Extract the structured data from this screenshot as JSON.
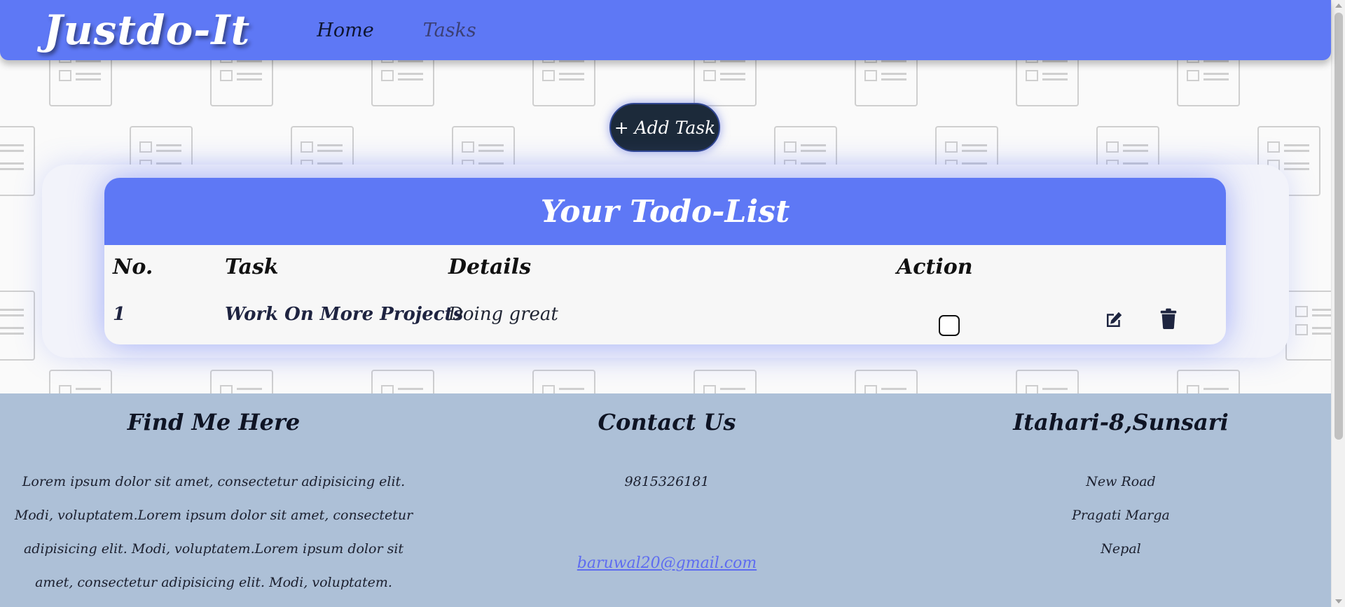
{
  "navbar": {
    "brand": "Justdo-It",
    "links": [
      "Home",
      "Tasks"
    ]
  },
  "actions": {
    "add_task_label": "+ Add Task"
  },
  "todo": {
    "title": "Your Todo-List",
    "columns": [
      "No.",
      "Task",
      "Details",
      "Action"
    ],
    "rows": [
      {
        "no": "1",
        "task": "Work On More Projects",
        "details": "Doing great",
        "done": false
      }
    ]
  },
  "footer": {
    "find_me": {
      "heading": "Find Me Here",
      "text": "Lorem ipsum dolor sit amet, consectetur adipisicing elit. Modi, voluptatem.Lorem ipsum dolor sit amet, consectetur adipisicing elit. Modi, voluptatem.Lorem ipsum dolor sit amet, consectetur adipisicing elit. Modi, voluptatem."
    },
    "contact": {
      "heading": "Contact Us",
      "phone": "9815326181",
      "email": "baruwal20@gmail.com"
    },
    "address": {
      "heading": "Itahari-8,Sunsari",
      "lines": [
        "New Road",
        "Pragati Marga",
        "Nepal"
      ]
    }
  },
  "colors": {
    "navbar": "#5e78f5",
    "footer": "#adc0d7",
    "add_button": "#1c2a3a",
    "email_link": "#5e6cf0"
  },
  "icons": [
    "edit-icon",
    "trash-icon",
    "document-icon"
  ]
}
